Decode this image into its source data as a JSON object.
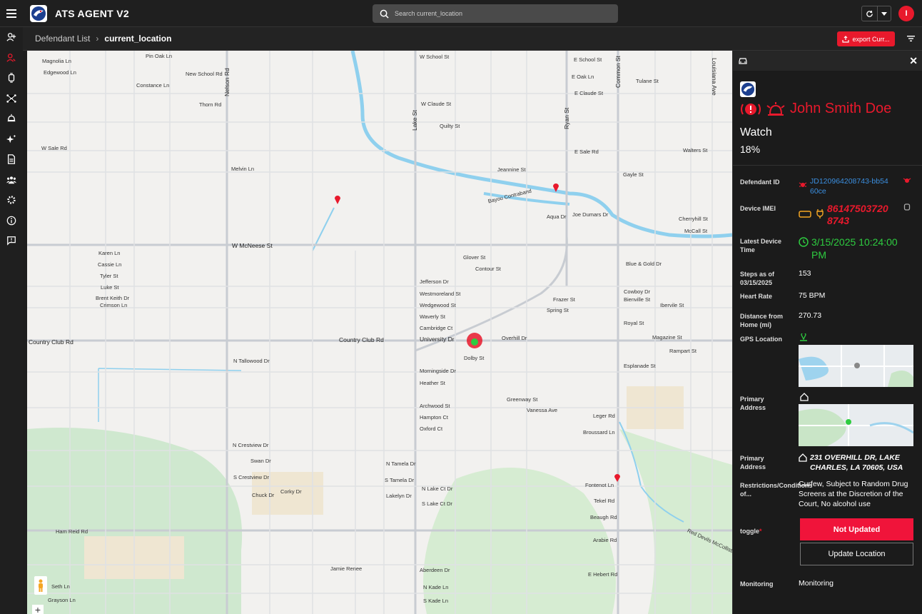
{
  "app": {
    "title": "ATS AGENT V2"
  },
  "search": {
    "placeholder": "Search current_location"
  },
  "user": {
    "initial": "I"
  },
  "breadcrumb": {
    "parent": "Defendant List",
    "separator": "›",
    "current": "current_location"
  },
  "toolbar": {
    "export_label": "export Curr..."
  },
  "colors": {
    "accent": "#e8192c",
    "link": "#3b8fe0",
    "ok": "#2ecc40",
    "warn": "#f5a623"
  },
  "rail": [
    {
      "icon": "add-user-icon"
    },
    {
      "icon": "user-active-icon"
    },
    {
      "icon": "device-icon"
    },
    {
      "icon": "network-icon"
    },
    {
      "icon": "alert-icon"
    },
    {
      "icon": "sparkle-icon"
    },
    {
      "icon": "document-icon"
    },
    {
      "icon": "group-icon"
    },
    {
      "icon": "settings-icon"
    },
    {
      "icon": "info-icon"
    },
    {
      "icon": "feedback-icon"
    }
  ],
  "map": {
    "labels": [
      "Pin Oak Ln",
      "Magnolia Ln",
      "Edgewood Ln",
      "New School Rd",
      "Constance Ln",
      "Thorn Rd",
      "W Sale Rd",
      "Melvin Ln",
      "W McNeese St",
      "Karen Ln",
      "Cassie Ln",
      "Tyler St",
      "Luke St",
      "Brent Keith Dr",
      "Crimson Ln",
      "Country Club Rd",
      "N Tallowood Dr",
      "Morningside Dr",
      "Heather St",
      "Archwood St",
      "Hampton Ct",
      "Oxford Ct",
      "N Crestview Dr",
      "Swan Dr",
      "S Crestview Dr",
      "Corky Dr",
      "Chuck Dr",
      "Ham Reid Rd",
      "Jamie Renee",
      "Seth Ln",
      "Grayson Ln",
      "N Tamela Dr",
      "S Tamela Dr",
      "Lakelyn Dr",
      "N Lake Ct Dr",
      "S Lake Ct Dr",
      "Aberdeen Dr",
      "N Kade Ln",
      "S Kade Ln",
      "W School St",
      "E School St",
      "E Oak Ln",
      "E Claude St",
      "W Claude St",
      "Quilty St",
      "Jeannine St",
      "E Sale Rd",
      "Gayle St",
      "Bayou Contraband",
      "Joe Dumars Dr",
      "Aqua Dr",
      "Glover St",
      "Contour St",
      "Jefferson Dr",
      "Westmoreland St",
      "Wedgewood St",
      "Waverly St",
      "Cambridge Ct",
      "University Dr",
      "Overhill Dr",
      "Dolby St",
      "Greenway St",
      "Vanessa Ave",
      "Frazer St",
      "Spring St",
      "Blue & Gold Dr",
      "Cowboy Dr",
      "Bienville St",
      "Ibervile St",
      "Royal St",
      "Magazine St",
      "Rampart St",
      "Esplanade St",
      "Leger Rd",
      "Broussard Ln",
      "Fontenot Ln",
      "Tekel Rd",
      "Beaugh Rd",
      "Arabie Rd",
      "E Hebert Rd",
      "Walters St",
      "Tulane St",
      "Cherryhill St",
      "McCall St",
      "Ryan St",
      "Lake St",
      "Nelson Rd",
      "Common St",
      "Louisiana Ave",
      "Red Devils McCollister",
      "Country Club Rd"
    ]
  },
  "panel": {
    "name": "John Smith Doe",
    "status": "Watch",
    "percent": "18%",
    "rows": {
      "defendant_id_label": "Defendant ID",
      "defendant_id": "JD120964208743-bb5460ce",
      "imei_label": "Device IMEI",
      "imei": "861475037208743",
      "latest_time_label": "Latest Device Time",
      "latest_time": "3/15/2025 10:24:00 PM",
      "steps_label": "Steps as of 03/15/2025",
      "steps": "153",
      "heart_label": "Heart Rate",
      "heart": "75 BPM",
      "distance_label": "Distance from Home (mi)",
      "distance": "270.73",
      "gps_label": "GPS Location",
      "primary_addr_label": "Primary Address",
      "primary_addr_label2": "Primary Address",
      "primary_addr": "231 OVERHILL DR, LAKE CHARLES, LA 70605, USA",
      "restrictions_label": "Restrictions/Conditions of...",
      "restrictions": "Curfew, Subject to Random Drug Screens at the Discretion of the Court, No alcohol use",
      "toggle_label": "toggle",
      "toggle_required": "*",
      "monitoring_label": "Monitoring",
      "monitoring": "Monitoring"
    },
    "buttons": {
      "not_updated": "Not Updated",
      "update_location": "Update Location"
    }
  }
}
